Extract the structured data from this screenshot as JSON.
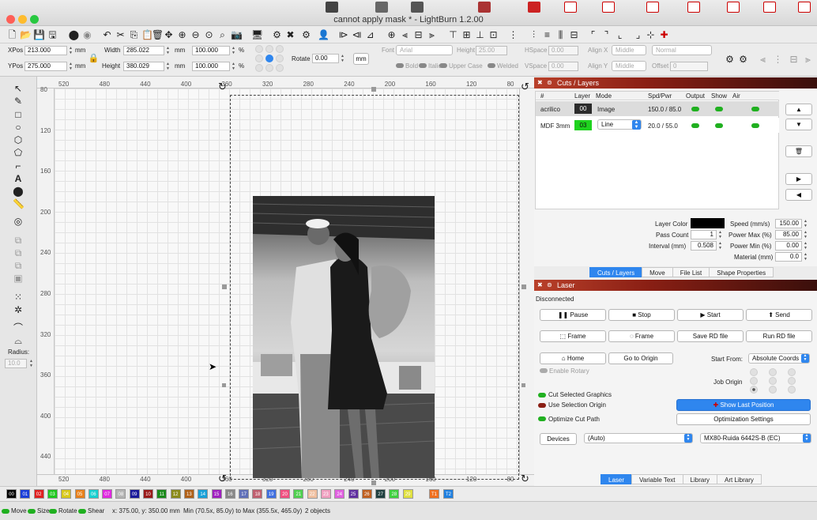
{
  "window": {
    "title": "cannot apply mask * - LightBurn 1.2.00"
  },
  "position": {
    "xpos_label": "XPos",
    "xpos_value": "213.000",
    "ypos_label": "YPos",
    "ypos_value": "275.000",
    "unit": "mm",
    "width_label": "Width",
    "width_value": "285.022",
    "height_label": "Height",
    "height_value": "380.029",
    "width_pct": "100.000",
    "height_pct": "100.000",
    "pct_unit": "%",
    "rotate_label": "Rotate",
    "rotate_value": "0.00",
    "mm_button": "mm"
  },
  "text_tools": {
    "font_label": "Font",
    "font_value": "Arial",
    "height_label": "Height",
    "height_value": "25.00",
    "hspace_label": "HSpace",
    "hspace_value": "0.00",
    "vspace_label": "VSpace",
    "vspace_value": "0.00",
    "alignx_label": "Align X",
    "alignx_value": "Middle",
    "aligny_label": "Align Y",
    "aligny_value": "Middle",
    "style_value": "Normal",
    "offset_label": "Offset",
    "offset_value": "0",
    "bold_label": "Bold",
    "italic_label": "Italic",
    "upper_label": "Upper Case",
    "welded_label": "Welded"
  },
  "left_tools": {
    "radius_label": "Radius:",
    "radius_value": "10.0"
  },
  "rulers": {
    "top": [
      "520",
      "480",
      "440",
      "400",
      "360",
      "320",
      "280",
      "240",
      "200",
      "160",
      "120",
      "80"
    ],
    "left": [
      "80",
      "120",
      "160",
      "200",
      "240",
      "280",
      "320",
      "360",
      "400",
      "440"
    ],
    "bottom": [
      "520",
      "480",
      "440",
      "400",
      "360",
      "320",
      "280",
      "240",
      "200",
      "160",
      "120",
      "80"
    ]
  },
  "cuts_panel": {
    "title": "Cuts / Layers",
    "columns": [
      "#",
      "Layer",
      "Mode",
      "Spd/Pwr",
      "Output",
      "Show",
      "Air"
    ],
    "rows": [
      {
        "name": "acrilico",
        "layer": "00",
        "layer_color": "#2b2b2b",
        "mode": "Image",
        "spdpwr": "150.0 / 85.0"
      },
      {
        "name": "MDF 3mm",
        "layer": "03",
        "layer_color": "#1ed21e",
        "mode": "Line",
        "spdpwr": "20.0 / 55.0"
      }
    ],
    "layer_color_label": "Layer Color",
    "layer_color_value": "#000000",
    "pass_count_label": "Pass Count",
    "pass_count_value": "1",
    "interval_label": "Interval (mm)",
    "interval_value": "0.508",
    "speed_label": "Speed (mm/s)",
    "speed_value": "150.00",
    "power_max_label": "Power Max (%)",
    "power_max_value": "85.00",
    "power_min_label": "Power Min (%)",
    "power_min_value": "0.00",
    "material_label": "Material (mm)",
    "material_value": "0.0",
    "tabs": [
      "Cuts / Layers",
      "Move",
      "File List",
      "Shape Properties"
    ]
  },
  "laser_panel": {
    "title": "Laser",
    "status": "Disconnected",
    "pause": "Pause",
    "stop": "Stop",
    "start": "Start",
    "send": "Send",
    "frame1": "Frame",
    "frame2": "Frame",
    "save_rd": "Save RD file",
    "run_rd": "Run RD file",
    "home": "Home",
    "go_to_origin": "Go to Origin",
    "start_from_label": "Start From:",
    "start_from_value": "Absolute Coords",
    "enable_rotary": "Enable Rotary",
    "job_origin_label": "Job Origin",
    "cut_selected": "Cut Selected Graphics",
    "use_selection_origin": "Use Selection Origin",
    "optimize_cut_path": "Optimize Cut Path",
    "show_last_position": "Show Last Position",
    "optimization_settings": "Optimization Settings",
    "devices": "Devices",
    "device_auto": "(Auto)",
    "device_model": "MX80-Ruida 6442S-B (EC)",
    "tabs": [
      "Laser",
      "Variable Text",
      "Library",
      "Art Library"
    ]
  },
  "palette": [
    {
      "label": "00",
      "color": "#000000"
    },
    {
      "label": "01",
      "color": "#1a3fd8"
    },
    {
      "label": "02",
      "color": "#e02020"
    },
    {
      "label": "03",
      "color": "#1ec81e"
    },
    {
      "label": "04",
      "color": "#d8c81a"
    },
    {
      "label": "05",
      "color": "#e8801a"
    },
    {
      "label": "06",
      "color": "#18d0d0"
    },
    {
      "label": "07",
      "color": "#e028e0"
    },
    {
      "label": "08",
      "color": "#b4b4b4"
    },
    {
      "label": "09",
      "color": "#1a1a9a"
    },
    {
      "label": "10",
      "color": "#9a1a1a"
    },
    {
      "label": "11",
      "color": "#1a8a1a"
    },
    {
      "label": "12",
      "color": "#8a8a1a"
    },
    {
      "label": "13",
      "color": "#b06018"
    },
    {
      "label": "14",
      "color": "#18a0d8"
    },
    {
      "label": "15",
      "color": "#a020c0"
    },
    {
      "label": "16",
      "color": "#888888"
    },
    {
      "label": "17",
      "color": "#6070b8"
    },
    {
      "label": "18",
      "color": "#c06070"
    },
    {
      "label": "19",
      "color": "#4070e0"
    },
    {
      "label": "20",
      "color": "#f05080"
    },
    {
      "label": "21",
      "color": "#50d050"
    },
    {
      "label": "22",
      "color": "#f0c0a0"
    },
    {
      "label": "23",
      "color": "#f0a0c0"
    },
    {
      "label": "24",
      "color": "#e060e0"
    },
    {
      "label": "25",
      "color": "#6030a0"
    },
    {
      "label": "26",
      "color": "#c06020"
    },
    {
      "label": "27",
      "color": "#204040"
    },
    {
      "label": "28",
      "color": "#40d040"
    },
    {
      "label": "29",
      "color": "#e0e040"
    },
    {
      "label": "T1",
      "color": "#f07020"
    },
    {
      "label": "T2",
      "color": "#2080e0"
    }
  ],
  "status_bar": {
    "move": "Move",
    "size": "Size",
    "rotate": "Rotate",
    "shear": "Shear",
    "coords": "x: 375.00, y: 350.00 mm",
    "bounds": "Min (70.5x, 85.0y) to Max (355.5x, 465.0y)",
    "count": "2 objects"
  }
}
